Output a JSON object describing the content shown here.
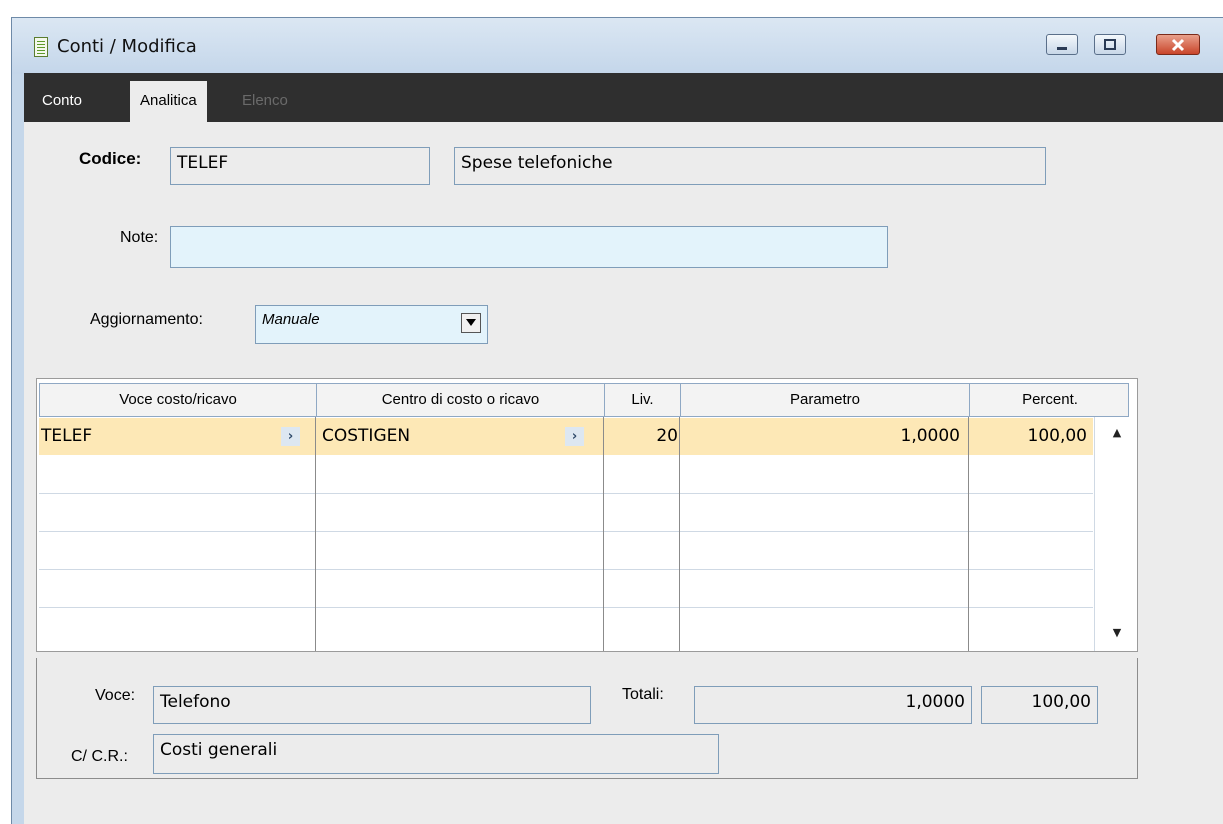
{
  "window": {
    "title": "Conti / Modifica"
  },
  "tabs": [
    {
      "label": "Conto",
      "state": "normal"
    },
    {
      "label": "Analitica",
      "state": "active"
    },
    {
      "label": "Elenco",
      "state": "disabled"
    }
  ],
  "form": {
    "codice_label": "Codice:",
    "codice_value": "TELEF",
    "descrizione_value": "Spese telefoniche",
    "note_label": "Note:",
    "note_value": "",
    "aggiornamento_label": "Aggiornamento:",
    "aggiornamento_value": "Manuale"
  },
  "grid": {
    "columns": [
      "Voce costo/ricavo",
      "Centro di costo o ricavo",
      "Liv.",
      "Parametro",
      "Percent."
    ],
    "rows": [
      {
        "voce": "TELEF",
        "centro": "COSTIGEN",
        "liv": "20",
        "parametro": "1,0000",
        "percent": "100,00"
      }
    ]
  },
  "footer": {
    "voce_label": "Voce:",
    "voce_value": "Telefono",
    "totali_label": "Totali:",
    "totale_parametro": "1,0000",
    "totale_percent": "100,00",
    "ccr_label": "C/ C.R.:",
    "ccr_value": "Costi generali"
  },
  "icons": {
    "window": "document-icon",
    "zoom": "chevron-right-icon",
    "dropdown": "triangle-down-icon"
  },
  "colors": {
    "tabbar": "#2f2f2f",
    "selected_row": "#fde8b6",
    "edit_field": "#e3f3fb",
    "titlebar": "#c4d6ea",
    "close_button": "#c9452a"
  }
}
